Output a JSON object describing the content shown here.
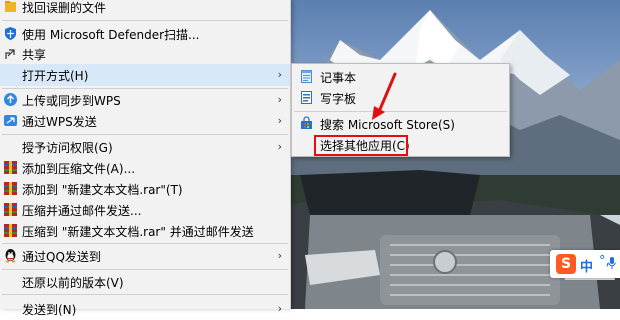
{
  "colors": {
    "menu_bg": "#f2f2f2",
    "hover_bg": "#d9e8f9",
    "highlight_red": "#e01010",
    "winrar_red": "#b8242a",
    "sogou_orange": "#ff5a1f"
  },
  "context_menu": {
    "items": [
      {
        "label": "找回误删的文件",
        "icon": "recover-file-icon"
      },
      {
        "label": "使用 Microsoft Defender扫描...",
        "icon": "defender-shield-icon"
      },
      {
        "label": "共享",
        "icon": "share-icon"
      },
      {
        "label": "打开方式(H)",
        "icon": "",
        "submenu": true
      },
      {
        "label": "上传或同步到WPS",
        "icon": "wps-cloud-icon",
        "submenu": true
      },
      {
        "label": "通过WPS发送",
        "icon": "wps-send-icon",
        "submenu": true
      },
      {
        "label": "授予访问权限(G)",
        "icon": "",
        "submenu": true
      },
      {
        "label": "添加到压缩文件(A)...",
        "icon": "winrar-icon"
      },
      {
        "label": "添加到 \"新建文本文档.rar\"(T)",
        "icon": "winrar-icon"
      },
      {
        "label": "压缩并通过邮件发送...",
        "icon": "winrar-icon"
      },
      {
        "label": "压缩到 \"新建文本文档.rar\" 并通过邮件发送",
        "icon": "winrar-icon"
      },
      {
        "label": "通过QQ发送到",
        "icon": "qq-penguin-icon",
        "submenu": true
      },
      {
        "label": "还原以前的版本(V)",
        "icon": ""
      },
      {
        "label": "发送到(N)",
        "icon": "",
        "submenu": true
      }
    ]
  },
  "open_with_submenu": {
    "items": [
      {
        "label": "记事本",
        "icon": "notepad-icon"
      },
      {
        "label": "写字板",
        "icon": "wordpad-icon"
      },
      {
        "label": "搜索 Microsoft Store(S)",
        "icon": "store-icon"
      },
      {
        "label": "选择其他应用(C)",
        "icon": ""
      }
    ]
  },
  "ime": {
    "logo": "S",
    "mode": "中",
    "punct": "°,"
  }
}
